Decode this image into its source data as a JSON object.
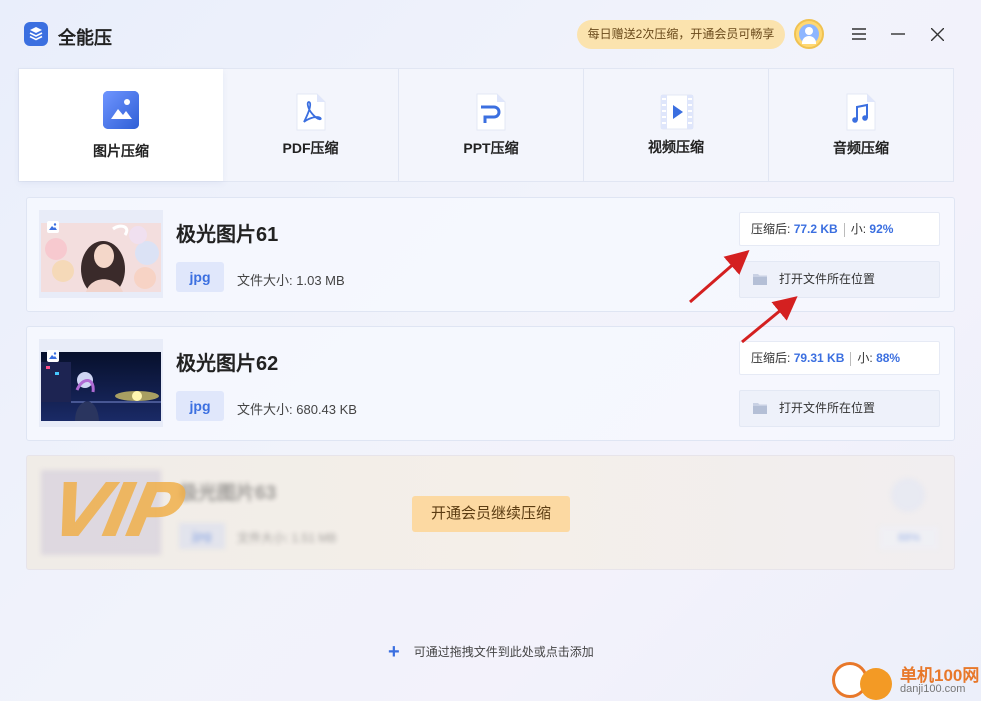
{
  "app": {
    "title": "全能压"
  },
  "header": {
    "promo": "每日赠送2次压缩，开通会员可畅享"
  },
  "tabs": [
    {
      "label": "图片压缩",
      "icon": "image-icon",
      "active": true
    },
    {
      "label": "PDF压缩",
      "icon": "pdf-icon",
      "active": false
    },
    {
      "label": "PPT压缩",
      "icon": "ppt-icon",
      "active": false
    },
    {
      "label": "视频压缩",
      "icon": "video-icon",
      "active": false
    },
    {
      "label": "音频压缩",
      "icon": "audio-icon",
      "active": false
    }
  ],
  "files": [
    {
      "name": "极光图片61",
      "type": "jpg",
      "size_label": "文件大小:",
      "size": "1.03 MB",
      "after_label": "压缩后:",
      "after_value": "77.2 KB",
      "ratio_label": "小:",
      "ratio_value": "92%",
      "open_label": "打开文件所在位置"
    },
    {
      "name": "极光图片62",
      "type": "jpg",
      "size_label": "文件大小:",
      "size": "680.43 KB",
      "after_label": "压缩后:",
      "after_value": "79.31 KB",
      "ratio_label": "小:",
      "ratio_value": "88%",
      "open_label": "打开文件所在位置"
    }
  ],
  "locked_file": {
    "name": "极光图片63",
    "type": "jpg",
    "size_text": "文件大小: 1.51 MB",
    "ratio": "88%",
    "vip_text": "VIP",
    "vip_button": "开通会员继续压缩"
  },
  "add_hint": "可通过拖拽文件到此处或点击添加",
  "watermark": {
    "title": "单机100网",
    "url": "danji100.com"
  },
  "colors": {
    "accent": "#3b6fe0",
    "promo_bg": "#fbe3ae",
    "vip_button_bg": "#fcd9a2",
    "arrow": "#d42020"
  }
}
